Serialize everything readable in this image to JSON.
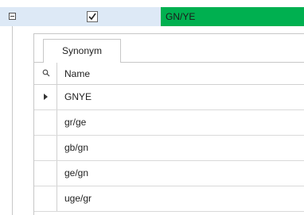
{
  "master_row": {
    "expanded": true,
    "checked": true,
    "color_name": "GN/YE",
    "color_bg": "#00b050",
    "row_bg": "#dde9f6"
  },
  "detail": {
    "tab_label": "Synonym",
    "grid": {
      "search_icon": "search-icon",
      "column_header": "Name",
      "rows": [
        {
          "name": "GNYE",
          "current": true
        },
        {
          "name": "gr/ge",
          "current": false
        },
        {
          "name": "gb/gn",
          "current": false
        },
        {
          "name": "ge/gn",
          "current": false
        },
        {
          "name": "uge/gr",
          "current": false
        }
      ]
    }
  }
}
